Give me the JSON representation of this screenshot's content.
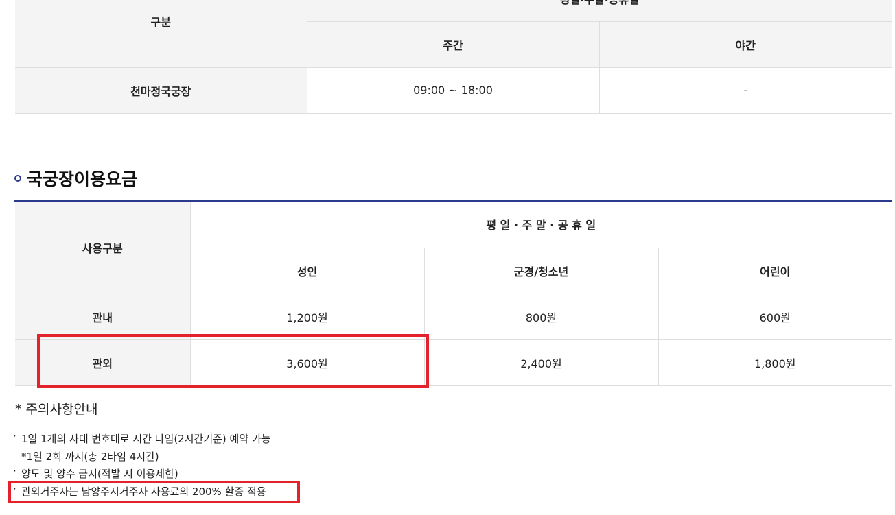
{
  "table1": {
    "header_col": "구분",
    "group_header": "평일·주말·공휴일",
    "sub_headers": [
      "주간",
      "야간"
    ],
    "rows": [
      {
        "name": "천마정국궁장",
        "values": [
          "09:00 ~ 18:00",
          "-"
        ]
      }
    ]
  },
  "section": {
    "title": "국궁장이용요금"
  },
  "table2": {
    "header_col": "사용구분",
    "group_header": "평 일 · 주 말 · 공 휴 일",
    "sub_headers": [
      "성인",
      "군경/청소년",
      "어린이"
    ],
    "rows": [
      {
        "name": "관내",
        "values": [
          "1,200원",
          "800원",
          "600원"
        ]
      },
      {
        "name": "관외",
        "values": [
          "3,600원",
          "2,400원",
          "1,800원"
        ]
      }
    ]
  },
  "notes": {
    "title": "* 주의사항안내",
    "bullet": "·",
    "items": [
      "1일 1개의 사대 번호대로 시간 타임(2시간기준) 예약 가능",
      "*1일 2회 까지(총 2타임 4시간)",
      "양도 및 양수 금지(적발 시 이용제한)",
      "관외거주자는 남양주시거주자 사용료의 200% 할증 적용"
    ]
  },
  "colors": {
    "accent": "#2b3a8c",
    "highlight": "#e4222b",
    "header_bg": "#f4f4f4",
    "border": "#dedede"
  }
}
